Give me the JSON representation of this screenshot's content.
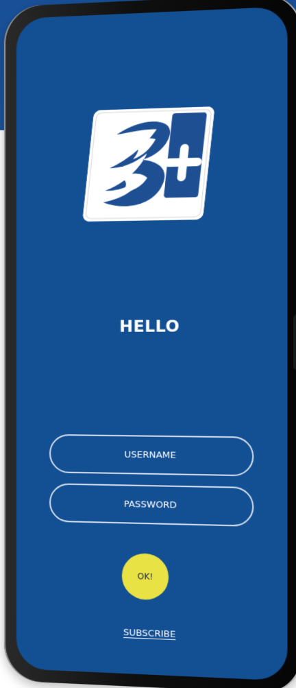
{
  "screen": {
    "title": "HELLO",
    "username_placeholder": "USERNAME",
    "password_placeholder": "PASSWORD",
    "ok_label": "OK!",
    "subscribe_label": "SUBSCRIBE"
  },
  "logo": {
    "text": "B+"
  },
  "colors": {
    "background_band": "#1a549c",
    "screen_bg": "#134f93",
    "button_yellow": "#e8e245",
    "text_white": "#ffffff",
    "logo_blue": "#1f4f93"
  }
}
